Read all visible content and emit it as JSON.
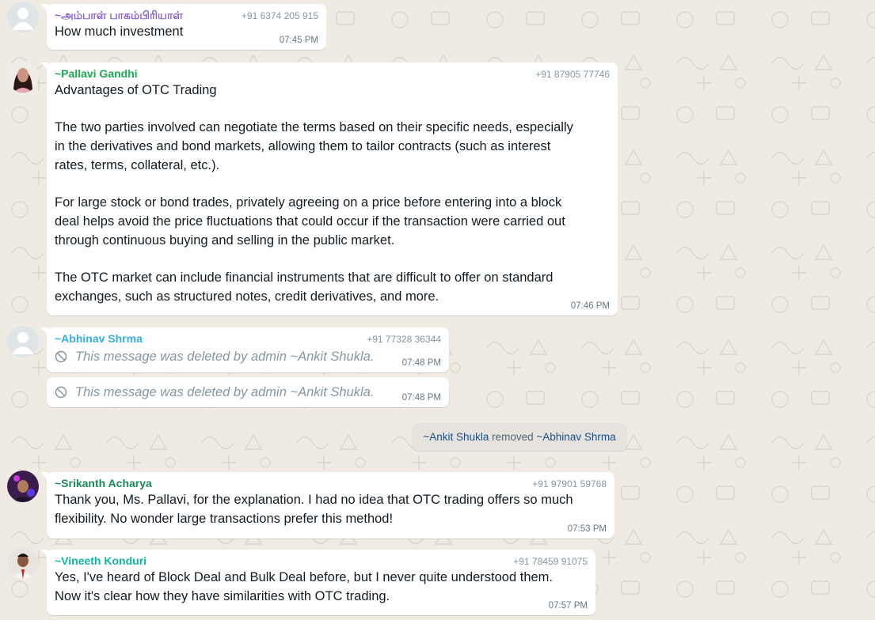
{
  "colors": {
    "chat_background": "#efeae2",
    "bubble": "#ffffff",
    "name_1": "#8a63d2",
    "name_2": "#1fa855",
    "name_3": "#35aee0",
    "name_4": "#1a8a5a",
    "name_5": "#13b5a0",
    "system_link": "#1b4f8a"
  },
  "messages": [
    {
      "sender": "~அம்பாள் பாகம்பிரியாள்",
      "phone": "+91 6374 205 915",
      "text": "How much investment",
      "time": "07:45 PM",
      "avatar": "default-avatar-icon"
    },
    {
      "sender": "~Pallavi Gandhi",
      "phone": "+91 87905 77746",
      "text": "Advantages of OTC Trading\n\nThe two parties involved can negotiate the terms based on their specific needs, especially\nin the derivatives and bond markets, allowing them to tailor contracts (such as interest\nrates, terms, collateral, etc.).\n\nFor large stock or bond trades, privately agreeing on a price before entering into a block\ndeal helps avoid the price fluctuations that could occur if the transaction were carried out\nthrough continuous buying and selling in the public market.\n\nThe OTC market can include financial instruments that are difficult to offer on standard\nexchanges, such as structured notes, credit derivatives, and more.",
      "time": "07:46 PM",
      "avatar": "profile-photo"
    },
    {
      "sender": "~Abhinav Shrma",
      "phone": "+91 77328 36344",
      "text": "This message was deleted by admin ~Ankit Shukla.",
      "time": "07:48 PM",
      "avatar": "default-avatar-icon"
    },
    {
      "text": "This message was deleted by admin ~Ankit Shukla.",
      "time": "07:48 PM"
    },
    {
      "sender": "~Srikanth Acharya",
      "phone": "+91 97901 59768",
      "text": "Thank you, Ms. Pallavi, for the explanation. I had no idea that OTC trading offers so much\nflexibility. No wonder large transactions prefer this method!",
      "time": "07:53 PM",
      "avatar": "profile-photo"
    },
    {
      "sender": "~Vineeth Konduri",
      "phone": "+91 78459 91075",
      "text": "Yes, I've heard of Block Deal and Bulk Deal before, but I never quite understood them.\nNow it's clear how they have similarities with OTC trading.",
      "time": "07:57 PM",
      "avatar": "profile-photo"
    }
  ],
  "system_message": {
    "actor": "~Ankit Shukla",
    "action": "removed",
    "target": "~Abhinav Shrma"
  }
}
